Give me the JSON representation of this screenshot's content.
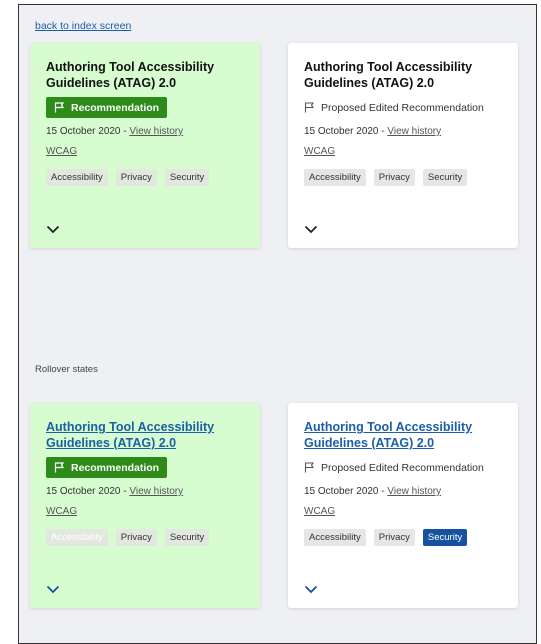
{
  "nav": {
    "back_label": "back to index screen"
  },
  "section": {
    "rollover_label": "Rollover states"
  },
  "cards": [
    {
      "title": "Authoring Tool Accessibility Guidelines (ATAG) 2.0",
      "status": "Recommendation",
      "date": "15 October 2020 - ",
      "history_label": "View history",
      "group": "WCAG",
      "tags": [
        "Accessibility",
        "Privacy",
        "Security"
      ],
      "active_tag": ""
    },
    {
      "title": "Authoring Tool Accessibility Guidelines (ATAG) 2.0",
      "status": "Proposed Edited Recommendation",
      "date": "15 October 2020 - ",
      "history_label": "View history",
      "group": "WCAG",
      "tags": [
        "Accessibility",
        "Privacy",
        "Security"
      ],
      "active_tag": ""
    },
    {
      "title": "Authoring Tool Accessibility Guidelines (ATAG) 2.0",
      "status": "Recommendation",
      "date": "15 October 2020 - ",
      "history_label": "View history",
      "group": "WCAG",
      "tags": [
        "Accessibility",
        "Privacy",
        "Security"
      ],
      "active_tag": "Accessibility"
    },
    {
      "title": "Authoring Tool Accessibility Guidelines (ATAG) 2.0",
      "status": "Proposed Edited Recommendation",
      "date": "15 October 2020 - ",
      "history_label": "View history",
      "group": "WCAG",
      "tags": [
        "Accessibility",
        "Privacy",
        "Security"
      ],
      "active_tag": "Security"
    }
  ],
  "colors": {
    "page_bg": "#eff0f4",
    "green_card": "#d6fcd0",
    "badge_green": "#2e8b1a",
    "link_blue": "#1a5fa8",
    "active_tag": "#1553a0"
  },
  "icons": {
    "flag": "flag-icon",
    "chevron": "chevron-down-icon"
  }
}
